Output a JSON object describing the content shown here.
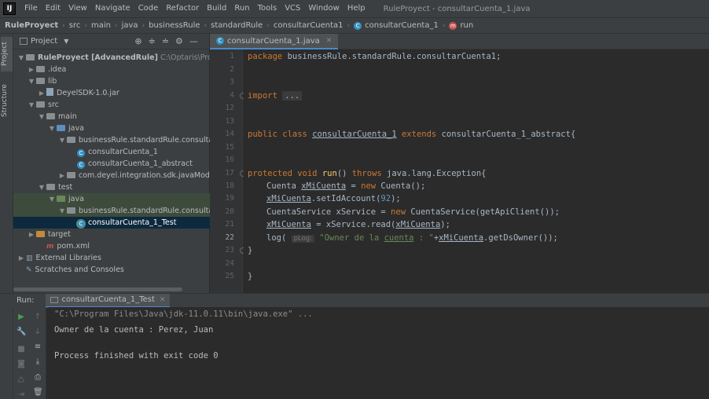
{
  "menubar": {
    "logo": "IJ",
    "items": [
      "File",
      "Edit",
      "View",
      "Navigate",
      "Code",
      "Refactor",
      "Build",
      "Run",
      "Tools",
      "VCS",
      "Window",
      "Help"
    ],
    "window_title": "RuleProyect - consultarCuenta_1.java"
  },
  "breadcrumbs": [
    "RuleProyect",
    "src",
    "main",
    "java",
    "businessRule",
    "standardRule",
    "consultarCuenta1",
    "consultarCuenta_1",
    "run"
  ],
  "side_tabs": {
    "project": "Project",
    "structure": "Structure"
  },
  "project_panel": {
    "title": "Project",
    "tree": [
      {
        "label": "RuleProyect [AdvancedRule]",
        "extra": "C:\\Optaris\\Proyectos\\Ru",
        "icon": "folder",
        "arrow": "down",
        "indent": 0
      },
      {
        "label": ".idea",
        "icon": "folder",
        "arrow": "right",
        "indent": 1
      },
      {
        "label": "lib",
        "icon": "folder",
        "arrow": "down",
        "indent": 1
      },
      {
        "label": "DeyelSDK-1.0.jar",
        "icon": "jar",
        "arrow": "right",
        "indent": 2
      },
      {
        "label": "src",
        "icon": "folder",
        "arrow": "down",
        "indent": 1
      },
      {
        "label": "main",
        "icon": "folder",
        "arrow": "down",
        "indent": 2
      },
      {
        "label": "java",
        "icon": "folder-blue",
        "arrow": "down",
        "indent": 3
      },
      {
        "label": "businessRule.standardRule.consultarCuen",
        "icon": "folder",
        "arrow": "down",
        "indent": 4
      },
      {
        "label": "consultarCuenta_1",
        "icon": "class",
        "arrow": "",
        "indent": 5
      },
      {
        "label": "consultarCuenta_1_abstract",
        "icon": "class",
        "arrow": "",
        "indent": 5
      },
      {
        "label": "com.deyel.integration.sdk.javaModels",
        "icon": "folder",
        "arrow": "right",
        "indent": 4
      },
      {
        "label": "test",
        "icon": "folder",
        "arrow": "down",
        "indent": 2
      },
      {
        "label": "java",
        "icon": "folder-green",
        "arrow": "down",
        "indent": 3,
        "state": "green"
      },
      {
        "label": "businessRule.standardRule.consultarCuen",
        "icon": "folder",
        "arrow": "down",
        "indent": 4,
        "state": "green"
      },
      {
        "label": "consultarCuenta_1_Test",
        "icon": "class-test",
        "arrow": "",
        "indent": 5,
        "state": "blue"
      },
      {
        "label": "target",
        "icon": "folder-orange",
        "arrow": "right",
        "indent": 1
      },
      {
        "label": "pom.xml",
        "icon": "maven",
        "arrow": "",
        "indent": 2
      },
      {
        "label": "External Libraries",
        "icon": "library",
        "arrow": "right",
        "indent": 0
      },
      {
        "label": "Scratches and Consoles",
        "icon": "scratch",
        "arrow": "",
        "indent": 0
      }
    ]
  },
  "editor": {
    "tab_label": "consultarCuenta_1.java",
    "line_numbers": [
      "1",
      "2",
      "3",
      "4",
      "12",
      "13",
      "14",
      "15",
      "16",
      "17",
      "18",
      "19",
      "20",
      "21",
      "22",
      "23",
      "24",
      "25"
    ],
    "active_line": "22",
    "code": {
      "l1_kw": "package",
      "l1_rest": " businessRule.standardRule.consultarCuenta1;",
      "l4_kw": "import",
      "l4_folded": "...",
      "l14_kw1": "public class",
      "l14_name": "consultarCuenta_1",
      "l14_kw2": "extends",
      "l14_rest": "consultarCuenta_1_abstract{",
      "l17_kw1": "protected void",
      "l17_fn": "run",
      "l17_mid": "() ",
      "l17_kw2": "throws",
      "l17_rest": " java.lang.Exception{",
      "l18_a": "Cuenta ",
      "l18_var": "xMiCuenta",
      "l18_b": " = ",
      "l18_kw": "new",
      "l18_c": " Cuenta();",
      "l19_var": "xMiCuenta",
      "l19_a": ".setIdAccount(",
      "l19_num": "92",
      "l19_b": ");",
      "l20_a": "CuentaService xService = ",
      "l20_kw": "new",
      "l20_b": " CuentaService(getApiClient());",
      "l21_var": "xMiCuenta",
      "l21_a": " = xService.read(",
      "l21_var2": "xMiCuenta",
      "l21_b": ");",
      "l22_a": "log( ",
      "l22_hint": "pLog:",
      "l22_str1": " \"Owner de la ",
      "l22_str_u": "cuenta",
      "l22_str2": " : \"",
      "l22_b": "+",
      "l22_var": "xMiCuenta",
      "l22_c": ".getDsOwner());",
      "l23": "}",
      "l25": "}"
    }
  },
  "run_panel": {
    "label": "Run:",
    "tab_label": "consultarCuenta_1_Test",
    "console": [
      "\"C:\\Program Files\\Java\\jdk-11.0.11\\bin\\java.exe\" ...",
      "Owner de la cuenta : Perez, Juan",
      "",
      "Process finished with exit code 0"
    ]
  },
  "colors": {
    "keyword": "#cc7832",
    "string": "#6a8759",
    "number": "#6897bb",
    "function": "#ffc66d",
    "tab_accent": "#4a88c7",
    "run_green": "#499c54"
  }
}
